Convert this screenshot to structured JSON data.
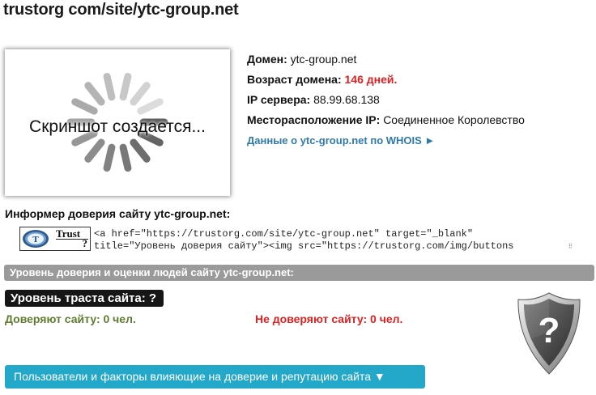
{
  "page": {
    "title": "trustorg com/site/ytc-group.net"
  },
  "screenshot": {
    "caption": "Скриншот создается..."
  },
  "info": {
    "domain_label": "Домен:",
    "domain_value": "ytc-group.net",
    "age_label": "Возраст домена:",
    "age_value": "146 дней",
    "age_suffix": ".",
    "ip_label": "IP сервера:",
    "ip_value": "88.99.68.138",
    "location_label": "Месторасположение IP:",
    "location_value": "Соединенное Королевство",
    "whois_link": "Данные о ytc-group.net по WHOIS ►"
  },
  "informer": {
    "title": "Информер доверия сайту ytc-group.net:",
    "badge_word": "Trust",
    "badge_q": "?",
    "code": "<a href=\"https://trustorg.com/site/ytc-group.net\" target=\"_blank\"\ntitle=\"Уровень доверия сайту\"><img src=\"https://trustorg.com/img/buttons"
  },
  "trust_section": {
    "bar_label": "Уровень доверия и оценки людей сайту ytc-group.net:",
    "level_label": "Уровень траста сайта: ?",
    "trust_yes": "Доверяют сайту: 0 чел.",
    "trust_no": "Не доверяют сайту: 0 чел.",
    "shield_symbol": "?"
  },
  "factors_button": {
    "label": "Пользователи и факторы влияющие на доверие и репутацию сайта ▼"
  },
  "colors": {
    "link": "#2f7aa9",
    "red": "#e02020",
    "green": "#5e7d2f",
    "section_bar": "#9a9a9a",
    "button": "#23a8c9"
  }
}
